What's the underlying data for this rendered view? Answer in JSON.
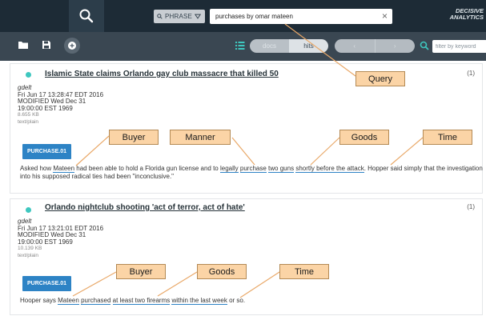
{
  "search": {
    "mode_label": "PHRASE",
    "query_value": "purchases by omar mateen",
    "clear_glyph": "×"
  },
  "brand": {
    "logo_line1": "DECISIVE",
    "logo_line2": "ANALYTICS"
  },
  "toolbar": {
    "toggle_left": "docs",
    "toggle_right": "hits",
    "prev_glyph": "‹",
    "next_glyph": "›",
    "filter_placeholder": "filter by keyword",
    "icons": [
      "folder-icon",
      "save-icon",
      "add-circle-icon",
      "list-icon",
      "search-icon"
    ]
  },
  "results": [
    {
      "title": "Islamic State claims Orlando gay club massacre that killed 50",
      "count": "(1)",
      "source": "gdelt",
      "date": "Fri Jun 17 13:28:47 EDT 2016",
      "modified": "MODIFIED Wed Dec 31",
      "modified_time": "19:00:00 EST 1969",
      "size": "8.655 KB",
      "mime": "text/plain",
      "badge": "PURCHASE.01",
      "snippet": {
        "p1": "Asked how ",
        "buyer": "Mateen",
        "p2": " had been able to hold a Florida gun license and to ",
        "manner": "legally",
        "p3": " ",
        "verb": "purchase",
        "p4": " ",
        "goods": "two guns",
        "p5": " ",
        "time": "shortly before the attack",
        "p6": ". Hopper said simply that the investigation into his supposed radical ties had been \"inconclusive.\""
      }
    },
    {
      "title": "Orlando nightclub shooting 'act of terror, act of hate'",
      "count": "(1)",
      "source": "gdelt",
      "date": "Fri Jun 17 13:21:01 EDT 2016",
      "modified": "MODIFIED Wed Dec 31",
      "modified_time": "19:00:00 EST 1969",
      "size": "10.139 KB",
      "mime": "text/plain",
      "badge": "PURCHASE.01",
      "snippet": {
        "p1": "Hooper says ",
        "buyer": "Mateen",
        "p2": " ",
        "verb": "purchased",
        "p3": " ",
        "goods": "at least two firearms",
        "p4": " ",
        "time": "within the last week",
        "p5": " or so."
      }
    }
  ],
  "callouts": {
    "query": "Query",
    "r1_buyer": "Buyer",
    "r1_manner": "Manner",
    "r1_goods": "Goods",
    "r1_time": "Time",
    "r2_buyer": "Buyer",
    "r2_goods": "Goods",
    "r2_time": "Time"
  },
  "colors": {
    "topbar": "#1d2b36",
    "toolbar": "#3a4752",
    "badge": "#2d83c5",
    "dot": "#3ec7bf",
    "callout": "#fbd4a6"
  }
}
